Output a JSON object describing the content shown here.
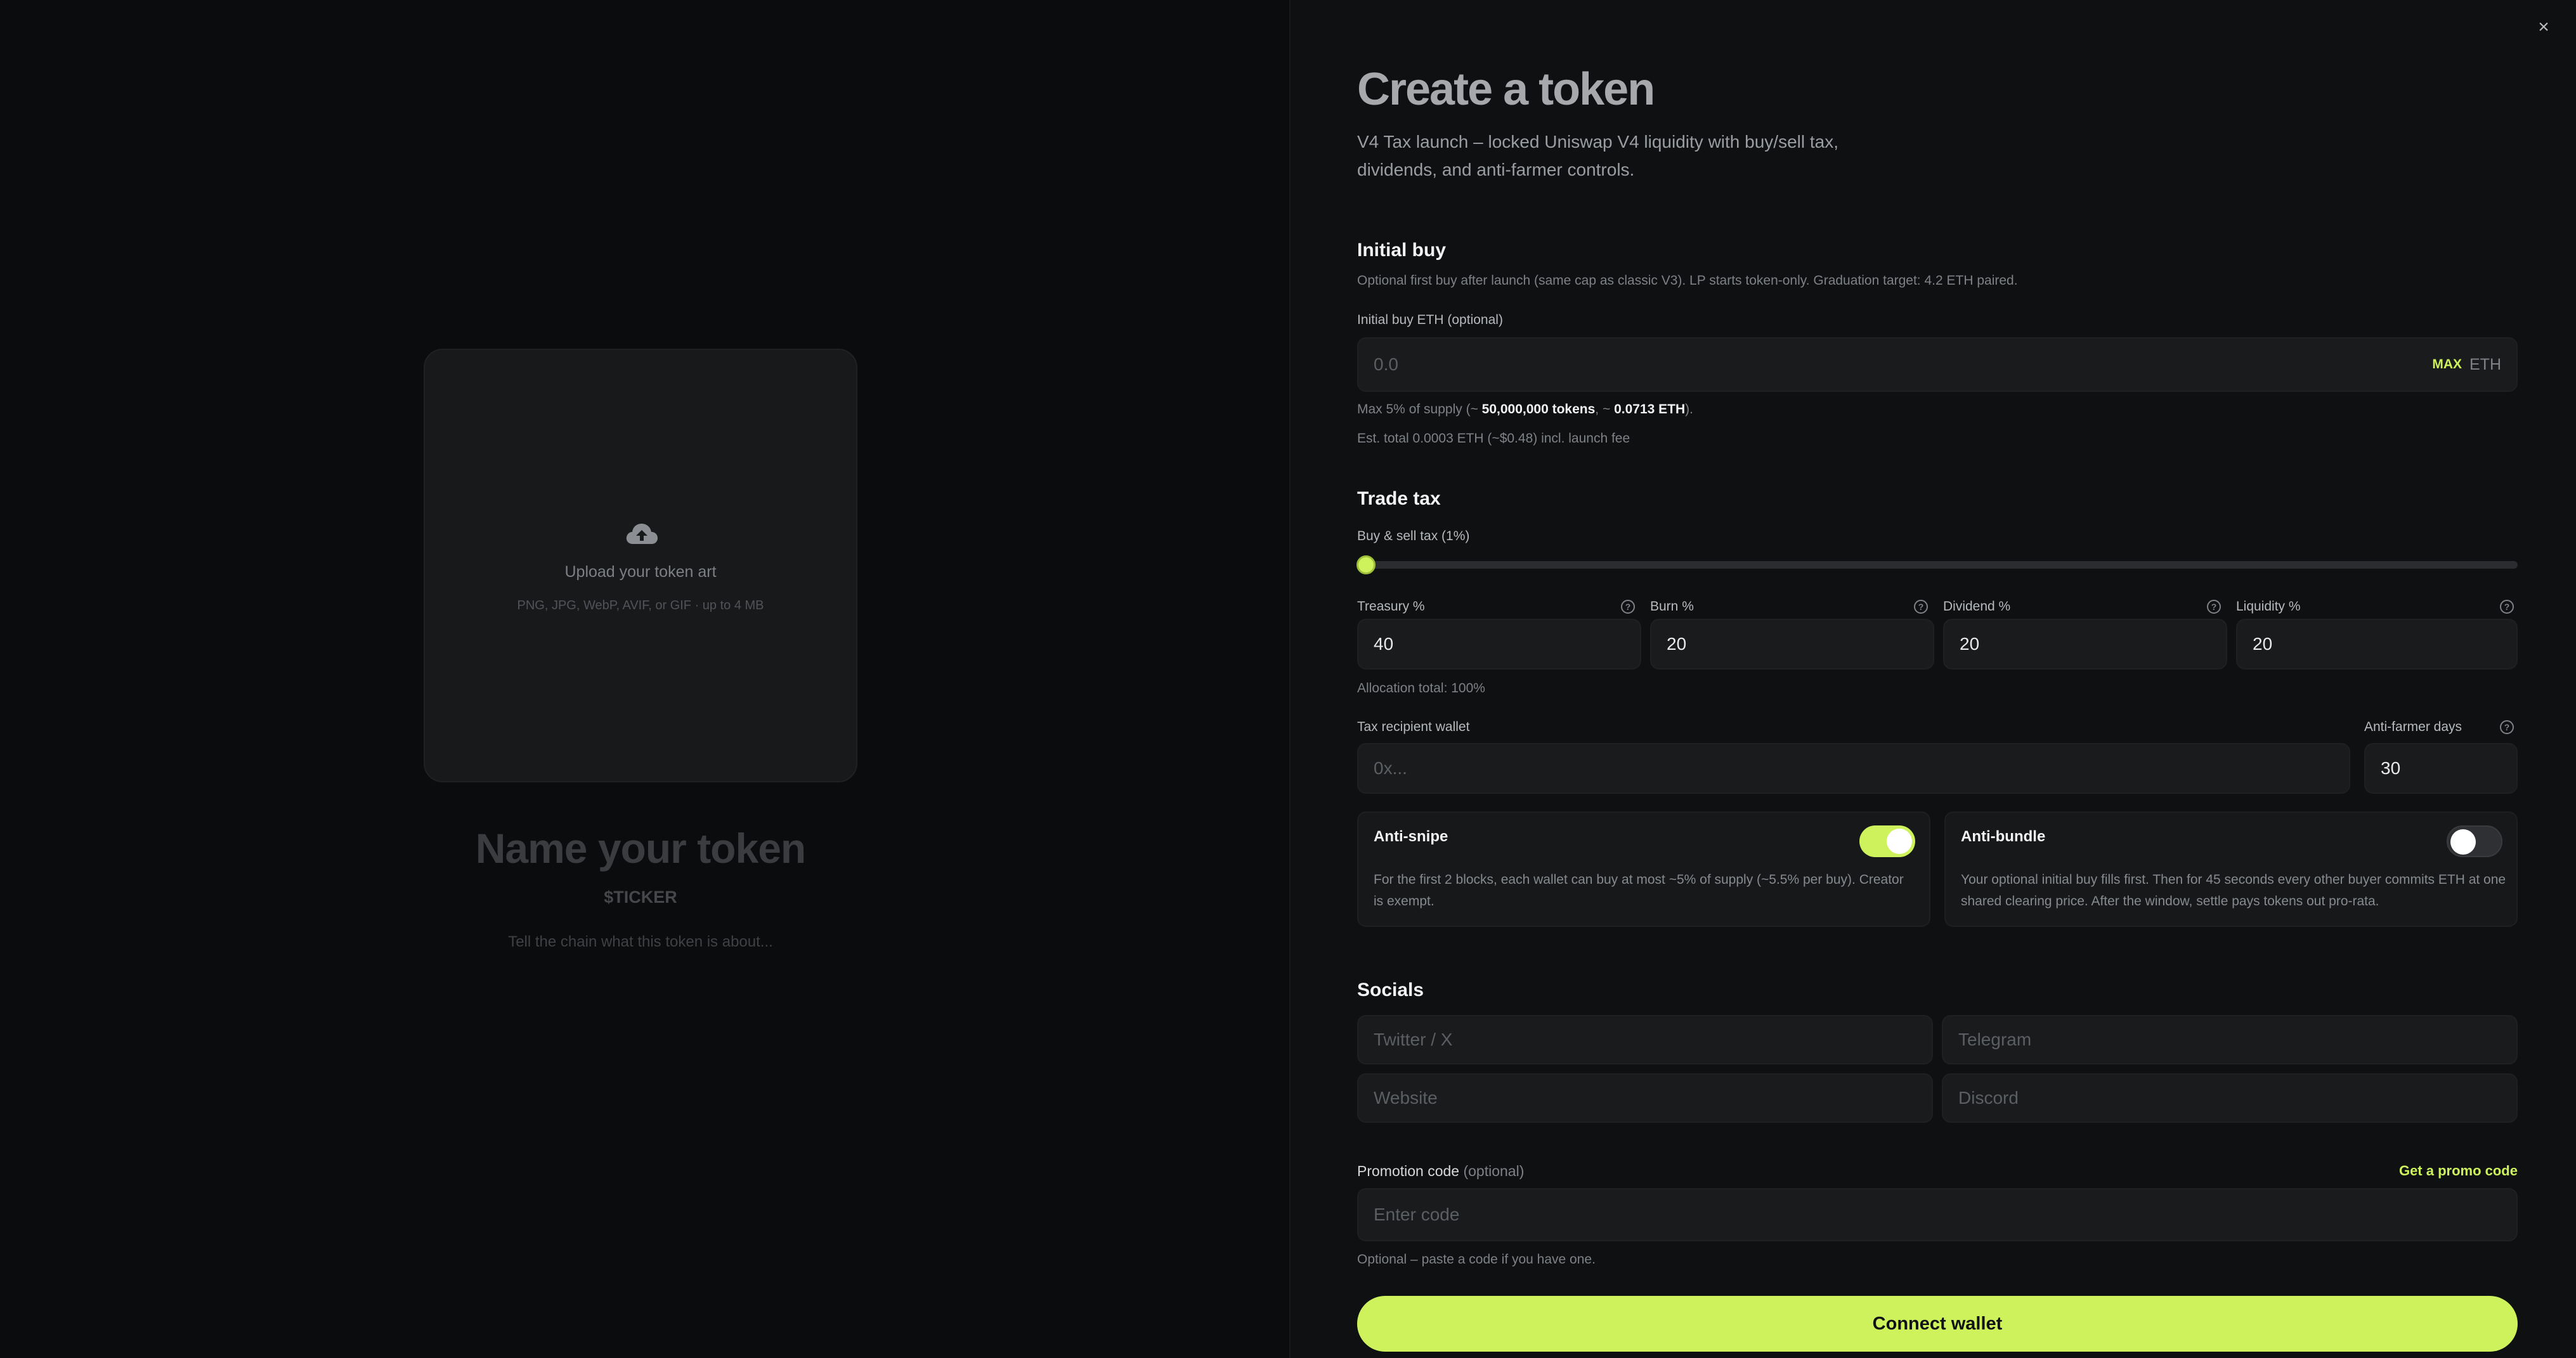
{
  "preview": {
    "upload_title": "Upload your token art",
    "upload_sub": "PNG, JPG, WebP, AVIF, or GIF · up to 4 MB",
    "name_placeholder": "Name your token",
    "ticker_placeholder": "$TICKER",
    "description_placeholder": "Tell the chain what this token is about..."
  },
  "panel": {
    "title": "Create a token",
    "intro": "V4 Tax launch – locked Uniswap V4 liquidity with buy/sell tax, dividends, and anti-farmer controls."
  },
  "initial_buy": {
    "title": "Initial buy",
    "description": "Optional first buy after launch (same cap as classic V3). LP starts token-only. Graduation target: 4.2 ETH paired.",
    "label": "Initial buy ETH (optional)",
    "placeholder": "0.0",
    "max_label": "MAX",
    "unit": "ETH",
    "cap_prefix": "Max 5% of supply (~ ",
    "cap_tokens": "50,000,000 tokens",
    "cap_mid": ", ~ ",
    "cap_eth": "0.0713 ETH",
    "cap_suffix": ").",
    "estimate": "Est. total 0.0003 ETH (~$0.48) incl. launch fee"
  },
  "trade_tax": {
    "title": "Trade tax",
    "slider_label": "Buy & sell tax (1%)",
    "slider_value": 1,
    "fields": [
      {
        "label": "Treasury %",
        "value": "40"
      },
      {
        "label": "Burn %",
        "value": "20"
      },
      {
        "label": "Dividend %",
        "value": "20"
      },
      {
        "label": "Liquidity %",
        "value": "20"
      }
    ],
    "allocation_total": "Allocation total: 100%",
    "wallet_label": "Tax recipient wallet",
    "wallet_placeholder": "0x...",
    "anti_farmer_label": "Anti-farmer days",
    "anti_farmer_value": "30"
  },
  "protections": {
    "anti_snipe": {
      "title": "Anti-snipe",
      "enabled": true,
      "body": "For the first 2 blocks, each wallet can buy at most ~5% of supply (~5.5% per buy). Creator is exempt."
    },
    "anti_bundle": {
      "title": "Anti-bundle",
      "enabled": false,
      "body": "Your optional initial buy fills first. Then for 45 seconds every other buyer commits ETH at one shared clearing price. After the window, settle pays tokens out pro-rata."
    }
  },
  "socials": {
    "title": "Socials",
    "twitter_placeholder": "Twitter / X",
    "telegram_placeholder": "Telegram",
    "website_placeholder": "Website",
    "discord_placeholder": "Discord"
  },
  "promo": {
    "label": "Promotion code",
    "label_suffix": "(optional)",
    "link": "Get a promo code",
    "placeholder": "Enter code",
    "hint": "Optional – paste a code if you have one."
  },
  "connect_label": "Connect wallet",
  "colors": {
    "accent": "#cdf25c",
    "background": "#0c0d0e",
    "panel": "#0f1012",
    "field": "#1a1b1d"
  },
  "icons": {
    "upload": "cloud-upload-icon",
    "close": "close-icon",
    "help": "question-circle-icon"
  }
}
